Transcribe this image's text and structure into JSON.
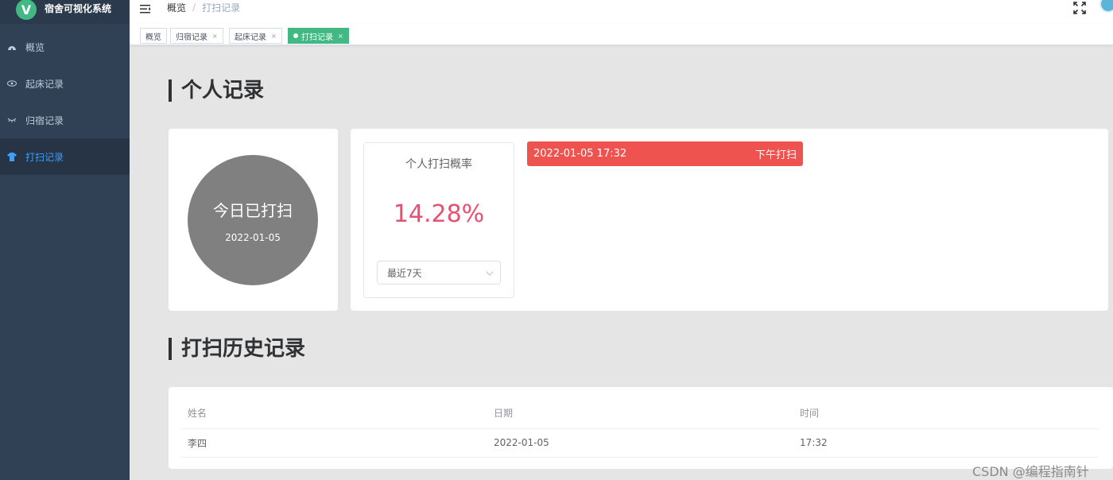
{
  "app": {
    "logo_letter": "V",
    "title": "宿舍可视化系统"
  },
  "sidebar": {
    "items": [
      {
        "label": "概览",
        "icon": "dashboard-icon",
        "active": false
      },
      {
        "label": "起床记录",
        "icon": "eye-icon",
        "active": false
      },
      {
        "label": "归宿记录",
        "icon": "closed-eye-icon",
        "active": false
      },
      {
        "label": "打扫记录",
        "icon": "shirt-icon",
        "active": true
      }
    ]
  },
  "navbar": {
    "breadcrumb": [
      "概览",
      "/",
      "打扫记录"
    ]
  },
  "tags": [
    {
      "label": "概览",
      "closable": false,
      "active": false
    },
    {
      "label": "归宿记录",
      "closable": true,
      "active": false
    },
    {
      "label": "起床记录",
      "closable": true,
      "active": false
    },
    {
      "label": "打扫记录",
      "closable": true,
      "active": true
    }
  ],
  "tag_close_symbol": "×",
  "personal": {
    "title": "个人记录",
    "status_text": "今日已打扫",
    "status_date": "2022-01-05",
    "rate_label": "个人打扫概率",
    "rate_value": "14.28%",
    "range_select": "最近7天",
    "alert": {
      "datetime": "2022-01-05 17:32",
      "label": "下午打扫",
      "color": "#ef5350"
    }
  },
  "history": {
    "title": "打扫历史记录",
    "columns": [
      "姓名",
      "日期",
      "时间"
    ],
    "rows": [
      [
        "李四",
        "2022-01-05",
        "17:32"
      ]
    ]
  },
  "watermark": "CSDN @编程指南针",
  "colors": {
    "sidebar_bg": "#304156",
    "active_menu": "#409eff",
    "active_tag": "#42b983",
    "rate": "#e8506f",
    "circle": "#808080"
  }
}
